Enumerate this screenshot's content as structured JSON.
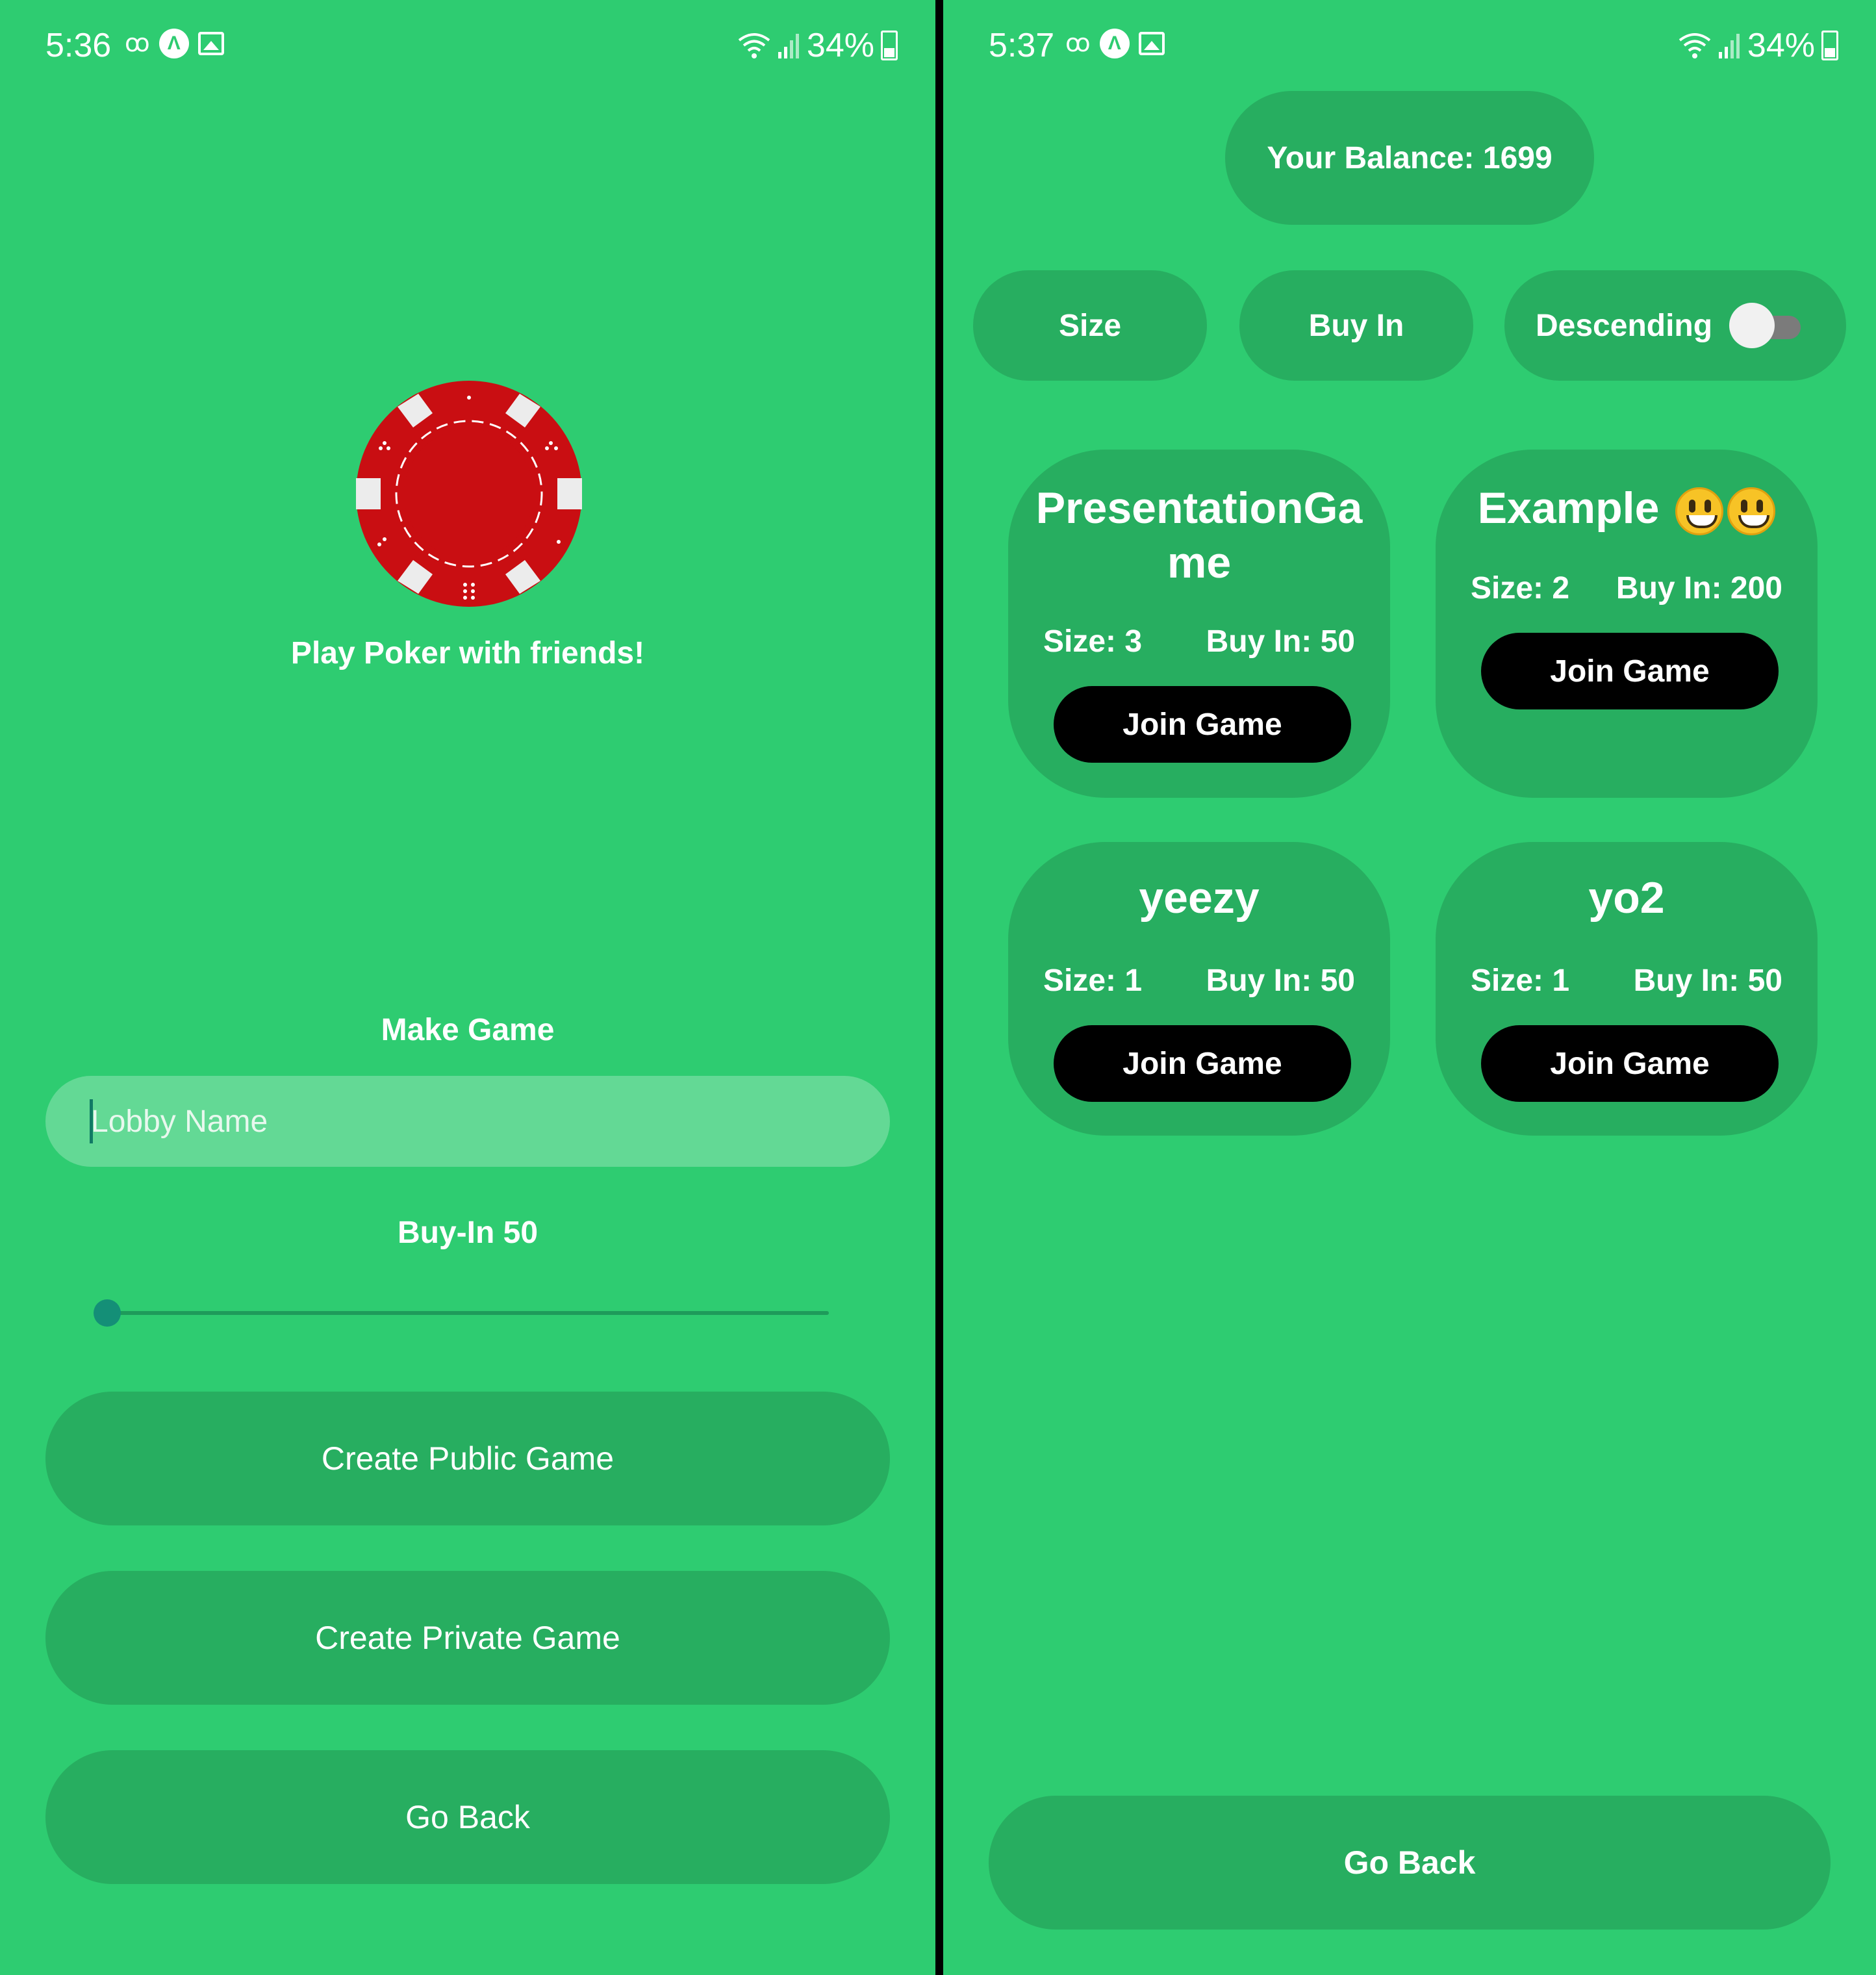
{
  "left": {
    "status": {
      "time": "5:36",
      "battery": "34%"
    },
    "tagline": "Play Poker with friends!",
    "make_game": {
      "title": "Make Game",
      "lobby_name_placeholder": "Lobby Name",
      "lobby_name_value": "",
      "buyin_label": "Buy-In 50",
      "buyin_fraction": 0
    },
    "buttons": {
      "create_public": "Create Public Game",
      "create_private": "Create Private Game",
      "go_back": "Go Back"
    }
  },
  "right": {
    "status": {
      "time": "5:37",
      "battery": "34%"
    },
    "balance": "Your Balance: 1699",
    "sort": {
      "size": "Size",
      "buy_in": "Buy In",
      "descending": "Descending",
      "descending_on": false
    },
    "lobbies": [
      {
        "name": "PresentationGame",
        "size": "Size: 3",
        "buy_in": "Buy In: 50",
        "join": "Join Game"
      },
      {
        "name": "Example",
        "size": "Size: 2",
        "buy_in": "Buy In: 200",
        "join": "Join Game"
      },
      {
        "name": "yeezy",
        "size": "Size: 1",
        "buy_in": "Buy In: 50",
        "join": "Join Game"
      },
      {
        "name": "yo2",
        "size": "Size: 1",
        "buy_in": "Buy In: 50",
        "join": "Join Game"
      }
    ],
    "go_back": "Go Back"
  },
  "colors": {
    "background": "#2ecc71",
    "button": "#27ae60",
    "input": "#63d995",
    "join": "#000000",
    "chip": "#c90e12"
  },
  "icons": [
    "voicemail-icon",
    "app-a-icon",
    "gallery-icon",
    "wifi-icon",
    "signal-icon",
    "battery-icon",
    "poker-chip-icon",
    "smiley-emoji-icon"
  ]
}
